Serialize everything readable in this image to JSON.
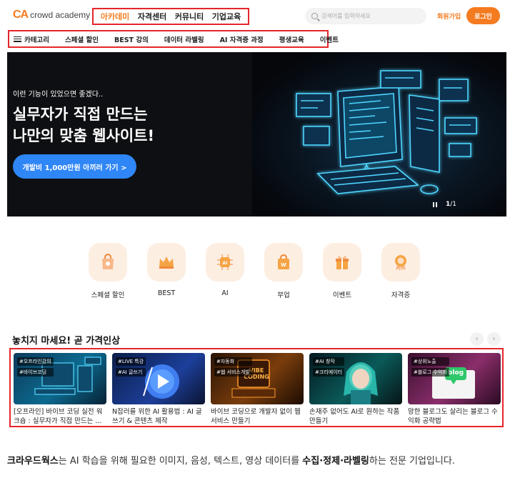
{
  "header": {
    "logo_mark": "CA",
    "logo_text": "crowd academy",
    "nav": [
      "아카데미",
      "자격센터",
      "커뮤니티",
      "기업교육"
    ],
    "search_placeholder": "검색어를 입력하세요",
    "signup": "회원가입",
    "login": "로그인"
  },
  "subnav": {
    "category": "카테고리",
    "items": [
      "스페셜 할인",
      "BEST 강의",
      "데이터 라벨링",
      "AI 자격증 과정",
      "평생교육",
      "이벤트"
    ]
  },
  "hero": {
    "subtitle": "이런 기능이 있었으면 좋겠다..",
    "title_line1": "실무자가 직접 만드는",
    "title_line2": "나만의 맞춤 웹사이트!",
    "cta": "개발비 1,000만원 아끼러 가기 >",
    "page_current": "1",
    "page_total": "/1"
  },
  "categories": [
    {
      "label": "스페셜 할인",
      "icon": "sale-bag-icon"
    },
    {
      "label": "BEST",
      "icon": "crown-icon"
    },
    {
      "label": "AI",
      "icon": "ai-chip-icon"
    },
    {
      "label": "부업",
      "icon": "shopping-bag-icon"
    },
    {
      "label": "이벤트",
      "icon": "gift-icon"
    },
    {
      "label": "자격증",
      "icon": "medal-icon"
    }
  ],
  "section": {
    "title": "놓치지 마세요! 곧 가격인상",
    "prev": "‹",
    "next": "›"
  },
  "cards": [
    {
      "tags": [
        "#오프라인강의",
        "#바이브코딩"
      ],
      "title": "[오프라인] 바이브 코딩 실전 워크숍 : 실무자가 직접 만드는 ..."
    },
    {
      "tags": [
        "#LIVE 특강",
        "#AI 글쓰기"
      ],
      "title": "N잡러를 위한 AI 활용법 : AI 글쓰기 & 콘텐츠 제작"
    },
    {
      "tags": [
        "#자동화",
        "#웹 서비스개발"
      ],
      "title": "바이브 코딩으로 개발자 없이 웹서비스 만들기",
      "overlay": "VIBE CODING"
    },
    {
      "tags": [
        "#AI 창작",
        "#크리에이터"
      ],
      "title": "손재주 없어도 AI로 원하는 작품 만들기"
    },
    {
      "tags": [
        "#상위노출",
        "#블로그 수익화"
      ],
      "title": "망한 블로그도 살리는 블로그 수익화 공략법",
      "overlay": "blog"
    }
  ],
  "footer": {
    "brand": "크라우드웍스",
    "text1": "는 AI 학습을 위해 필요한 이미지, 음성, 텍스트, 영상 데이터를 ",
    "strong": "수집·정제·라벨링",
    "text2": "하는 전문 기업입니다."
  },
  "colors": {
    "brand": "#f47b20",
    "highlight": "#e5262b",
    "cta": "#2f86f6"
  }
}
